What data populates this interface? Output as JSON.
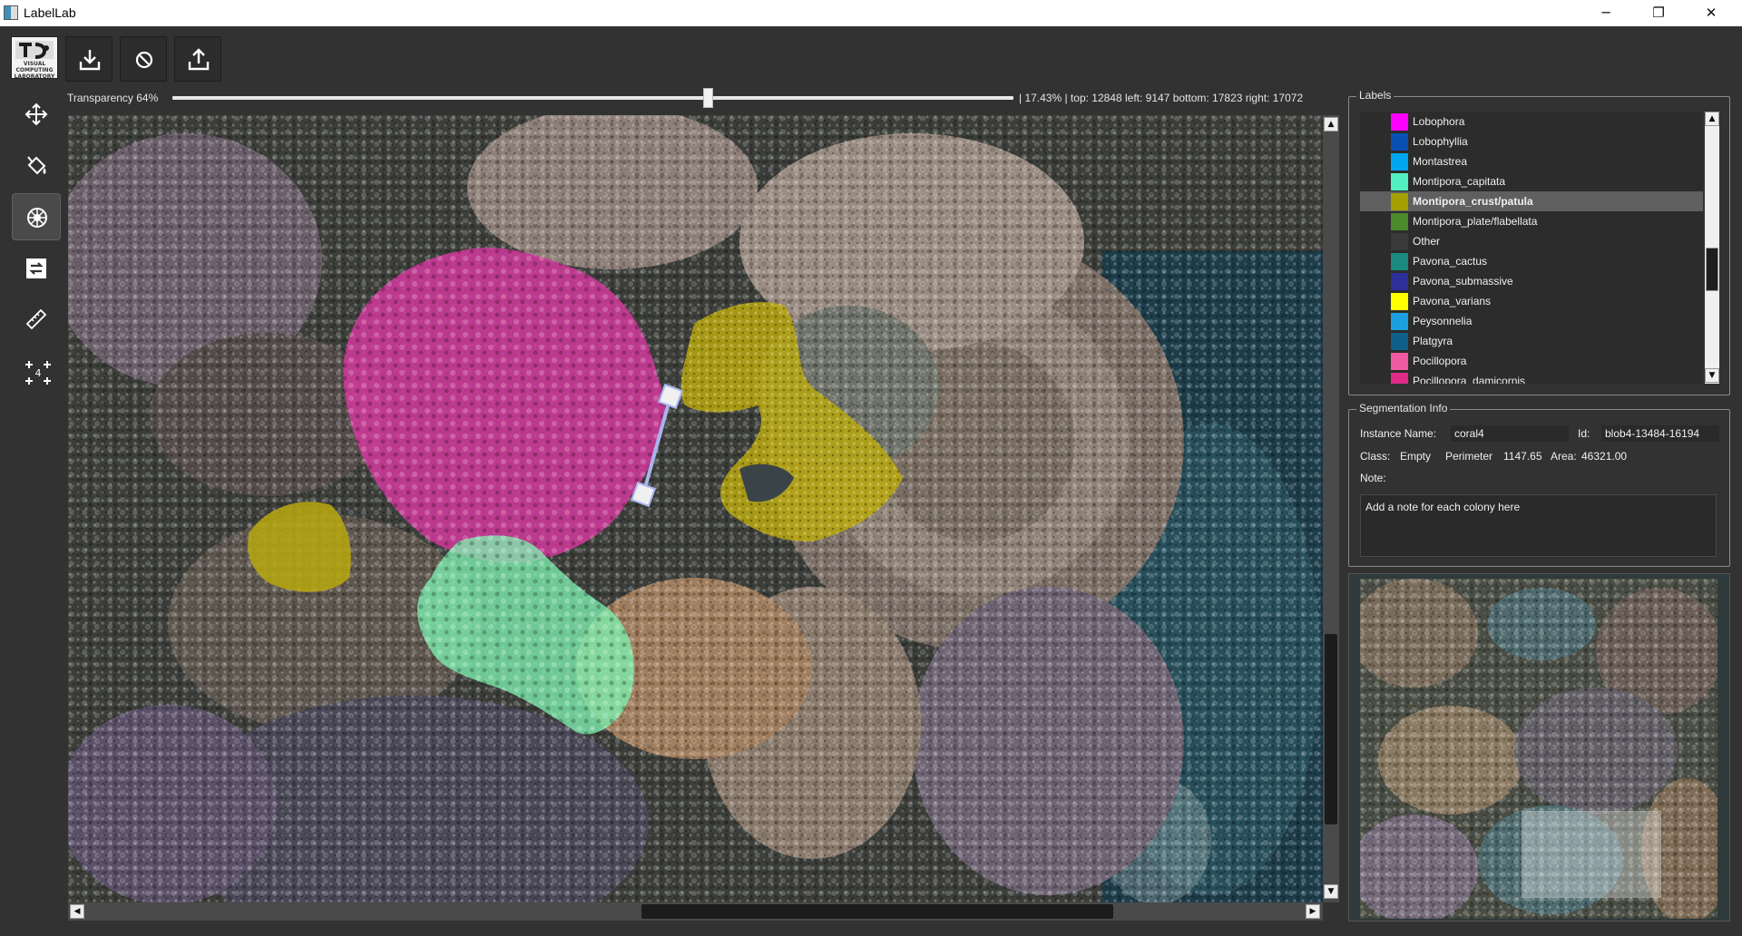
{
  "window": {
    "title": "LabelLab",
    "minimize": "─",
    "maximize": "❐",
    "close": "✕"
  },
  "toolbar": {
    "logo_icon": "viscore-logo",
    "logo_text": "VISUAL COMPUTING LABORATORY",
    "buttons": [
      {
        "name": "load-button",
        "icon": "download-icon"
      },
      {
        "name": "clear-button",
        "icon": "no-entry-icon"
      },
      {
        "name": "export-button",
        "icon": "upload-icon"
      }
    ]
  },
  "transparency": {
    "label": "Transparency 64%",
    "value_fraction": 0.64,
    "info": "|  17.43% | top: 12848 left: 9147 bottom: 17823 right: 17072"
  },
  "tools": [
    {
      "name": "move-tool",
      "icon": "move-icon",
      "active": false
    },
    {
      "name": "fill-tool",
      "icon": "paint-bucket-icon",
      "active": false
    },
    {
      "name": "coral-tool",
      "icon": "coral-icon",
      "active": true
    },
    {
      "name": "assign-tool",
      "icon": "swap-icon",
      "active": false
    },
    {
      "name": "ruler-tool",
      "icon": "ruler-icon",
      "active": false
    },
    {
      "name": "four-clicks-tool",
      "icon": "four-clicks-icon",
      "badge": "4",
      "active": false
    }
  ],
  "labels_panel": {
    "title": "Labels",
    "selected": "Montipora_crust/patula",
    "items": [
      {
        "name": "Lobophora",
        "color": "#ff00ff"
      },
      {
        "name": "Lobophyllia",
        "color": "#0a4fb3"
      },
      {
        "name": "Montastrea",
        "color": "#00a6f0"
      },
      {
        "name": "Montipora_capitata",
        "color": "#52f0c0"
      },
      {
        "name": "Montipora_crust/patula",
        "color": "#a3a000"
      },
      {
        "name": "Montipora_plate/flabellata",
        "color": "#4a8a2a"
      },
      {
        "name": "Other",
        "color": "#3a3a3a"
      },
      {
        "name": "Pavona_cactus",
        "color": "#1a8a80"
      },
      {
        "name": "Pavona_submassive",
        "color": "#2f2f9a"
      },
      {
        "name": "Pavona_varians",
        "color": "#ffff00"
      },
      {
        "name": "Peysonnelia",
        "color": "#1aa0e0"
      },
      {
        "name": "Platgyra",
        "color": "#105f8a"
      },
      {
        "name": "Pocillopora",
        "color": "#f05aa0"
      },
      {
        "name": "Pocillopora_damicornis",
        "color": "#e02a8a"
      }
    ]
  },
  "segmentation_info": {
    "title": "Segmentation Info",
    "instance_name_label": "Instance Name:",
    "instance_name": "coral4",
    "id_label": "Id:",
    "id": "blob4-13484-16194",
    "class_label": "Class:",
    "class_value": "Empty",
    "perimeter_label": "Perimeter",
    "perimeter": "1147.65",
    "area_label": "Area:",
    "area": "46321.00",
    "note_label": "Note:",
    "note_placeholder": "Add a note for each colony here"
  },
  "scrollbars": {
    "up": "▲",
    "down": "▼",
    "left": "◀",
    "right": "▶"
  },
  "colors": {
    "pink_region": "#d23a9c",
    "yellow_region": "#b8a80e",
    "green_region": "#7ef0b0",
    "ruler": "#aab4f0"
  }
}
